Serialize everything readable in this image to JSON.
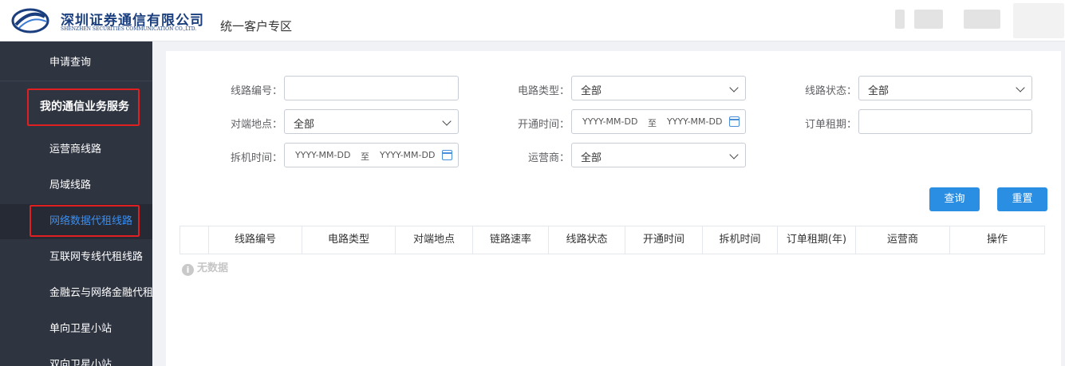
{
  "header": {
    "company_name_cn": "深圳证券通信有限公司",
    "company_name_en": "SHENZHEN SECURITIES COMMUNICATION CO.,LTD.",
    "page_title": "统一客户专区",
    "logo_icon": "company-logo-icon"
  },
  "sidebar": {
    "items": [
      {
        "label": "申请查询",
        "type": "item"
      },
      {
        "label": "我的通信业务服务",
        "type": "group"
      },
      {
        "label": "运营商线路",
        "type": "item"
      },
      {
        "label": "局域线路",
        "type": "item"
      },
      {
        "label": "网络数据代租线路",
        "type": "item",
        "active": true
      },
      {
        "label": "互联网专线代租线路",
        "type": "item"
      },
      {
        "label": "金融云与网络金融代租",
        "type": "item"
      },
      {
        "label": "单向卫星小站",
        "type": "item"
      },
      {
        "label": "双向卫星小站",
        "type": "item"
      }
    ],
    "active_color": "#3c8eee",
    "bg_color": "#2f3441"
  },
  "filters": {
    "line_no": {
      "label": "线路编号：",
      "value": ""
    },
    "circuit_type": {
      "label": "电路类型：",
      "value": "全部"
    },
    "line_status": {
      "label": "线路状态：",
      "value": "全部"
    },
    "peer_location": {
      "label": "对端地点：",
      "value": "全部"
    },
    "open_time": {
      "label": "开通时间：",
      "start": "YYYY-MM-DD",
      "sep": "至",
      "end": "YYYY-MM-DD"
    },
    "rent_period": {
      "label": "订单租期：",
      "value": ""
    },
    "remove_time": {
      "label": "拆机时间：",
      "start": "YYYY-MM-DD",
      "sep": "至",
      "end": "YYYY-MM-DD"
    },
    "operator": {
      "label": "运营商：",
      "value": "全部"
    }
  },
  "buttons": {
    "query": "查询",
    "reset": "重置"
  },
  "table": {
    "columns": [
      "",
      "线路编号",
      "电路类型",
      "对端地点",
      "链路速率",
      "线路状态",
      "开通时间",
      "拆机时间",
      "订单租期(年)",
      "运营商",
      "操作"
    ],
    "empty_text": "无数据",
    "empty_icon": "info-icon"
  },
  "accent_color": "#2a8ee2"
}
